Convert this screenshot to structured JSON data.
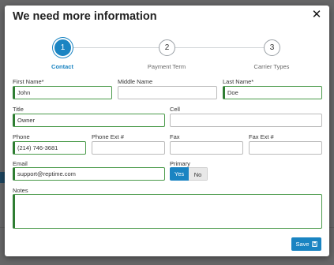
{
  "modal": {
    "title": "We need more information",
    "close_glyph": "✕",
    "save_label": "Save"
  },
  "steps": [
    {
      "number": "1",
      "label": "Contact",
      "active": true
    },
    {
      "number": "2",
      "label": "Payment Term",
      "active": false
    },
    {
      "number": "3",
      "label": "Carrier Types",
      "active": false
    }
  ],
  "form": {
    "first_name": {
      "label": "First Name*",
      "value": "John"
    },
    "middle_name": {
      "label": "Middle Name",
      "value": ""
    },
    "last_name": {
      "label": "Last Name*",
      "value": "Doe"
    },
    "title": {
      "label": "Title",
      "value": "Owner"
    },
    "cell": {
      "label": "Cell",
      "value": ""
    },
    "phone": {
      "label": "Phone",
      "value": "(214) 746-3681"
    },
    "phone_ext": {
      "label": "Phone Ext #",
      "value": ""
    },
    "fax": {
      "label": "Fax",
      "value": ""
    },
    "fax_ext": {
      "label": "Fax Ext #",
      "value": ""
    },
    "email": {
      "label": "Email",
      "value": "support@reptime.com"
    },
    "primary": {
      "label": "Primary",
      "yes": "Yes",
      "no": "No",
      "selected": "Yes"
    },
    "notes": {
      "label": "Notes",
      "value": ""
    }
  },
  "colors": {
    "accent": "#1a84c2",
    "valid": "#2e7d32"
  },
  "icons": {
    "close": "close-icon",
    "save": "floppy-disk-icon"
  }
}
